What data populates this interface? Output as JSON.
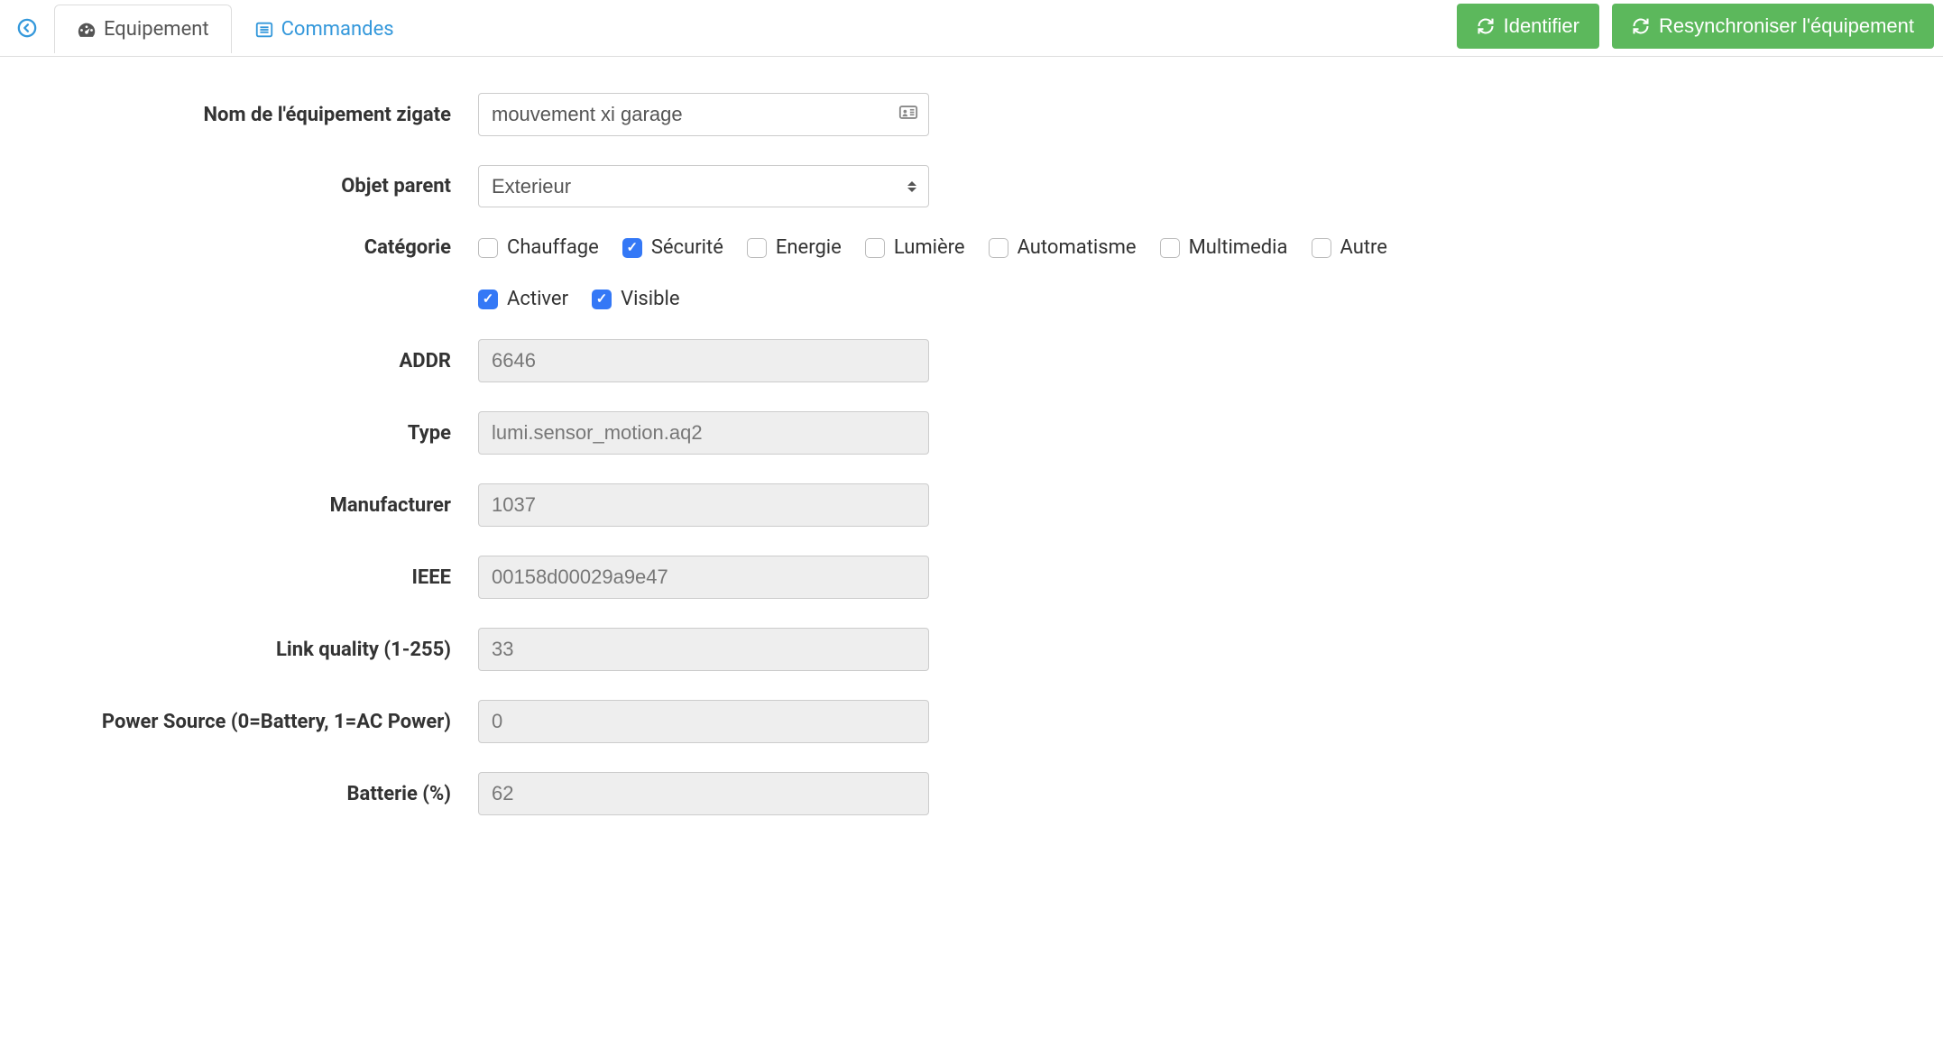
{
  "topbar": {
    "tabs": [
      {
        "label": "Equipement",
        "active": true
      },
      {
        "label": "Commandes",
        "active": false
      }
    ],
    "actions": {
      "identify": "Identifier",
      "resync": "Resynchroniser l'équipement"
    }
  },
  "form": {
    "name": {
      "label": "Nom de l'équipement zigate",
      "value": "mouvement xi garage"
    },
    "parent": {
      "label": "Objet parent",
      "value": "Exterieur"
    },
    "category": {
      "label": "Catégorie",
      "items": [
        {
          "label": "Chauffage",
          "checked": false
        },
        {
          "label": "Sécurité",
          "checked": true
        },
        {
          "label": "Energie",
          "checked": false
        },
        {
          "label": "Lumière",
          "checked": false
        },
        {
          "label": "Automatisme",
          "checked": false
        },
        {
          "label": "Multimedia",
          "checked": false
        },
        {
          "label": "Autre",
          "checked": false
        }
      ]
    },
    "flags": {
      "activate": {
        "label": "Activer",
        "checked": true
      },
      "visible": {
        "label": "Visible",
        "checked": true
      }
    },
    "addr": {
      "label": "ADDR",
      "value": "6646"
    },
    "type": {
      "label": "Type",
      "value": "lumi.sensor_motion.aq2"
    },
    "manufacturer": {
      "label": "Manufacturer",
      "value": "1037"
    },
    "ieee": {
      "label": "IEEE",
      "value": "00158d00029a9e47"
    },
    "link_quality": {
      "label": "Link quality (1-255)",
      "value": "33"
    },
    "power_source": {
      "label": "Power Source (0=Battery, 1=AC Power)",
      "value": "0"
    },
    "battery": {
      "label": "Batterie (%)",
      "value": "62"
    }
  }
}
